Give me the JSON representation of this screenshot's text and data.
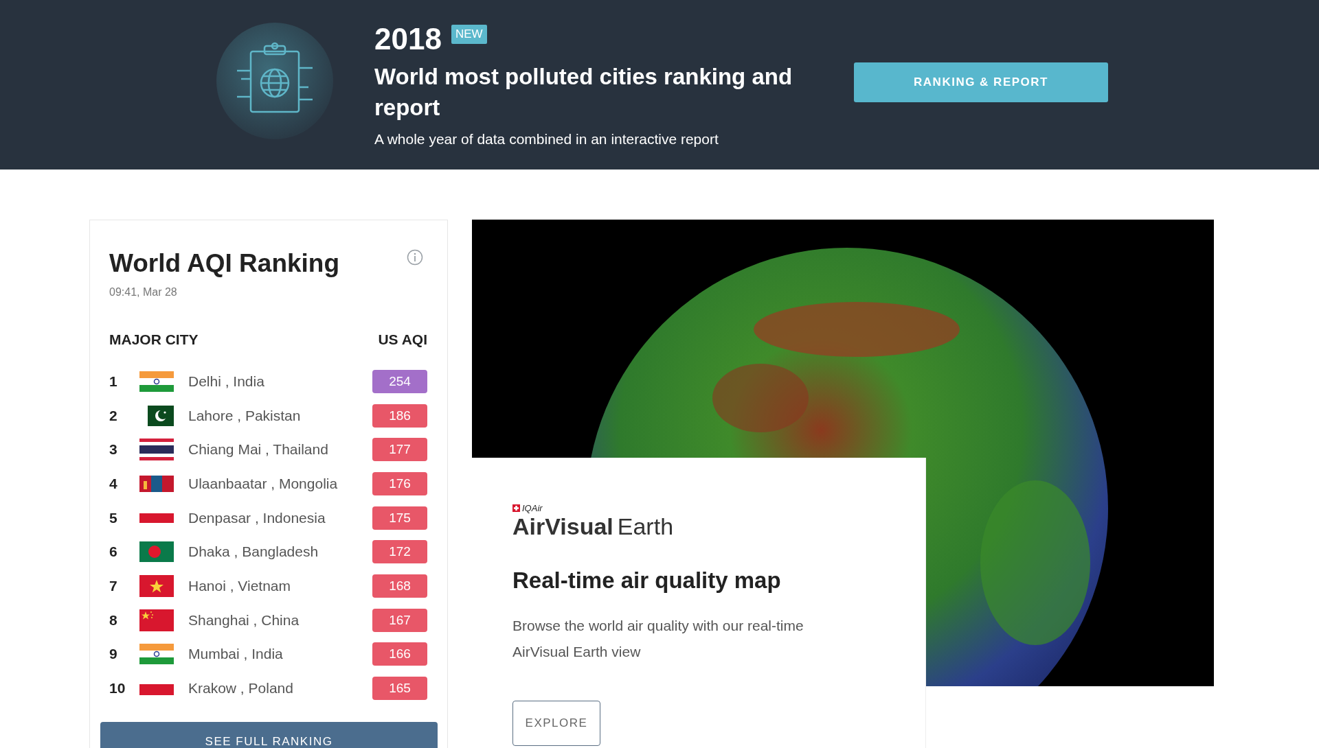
{
  "banner": {
    "year": "2018",
    "badge": "NEW",
    "title": "World most polluted cities ranking and report",
    "subtitle": "A whole year of data combined in an interactive report",
    "button": "RANKING & REPORT"
  },
  "ranking": {
    "title": "World AQI Ranking",
    "updated": "09:41, Mar 28",
    "columns": [
      "MAJOR CITY",
      "US AQI"
    ],
    "rows": [
      {
        "rank": "1",
        "kind": "india",
        "city": "Delhi , India",
        "aqi": "254",
        "color": "#a36fc9"
      },
      {
        "rank": "2",
        "kind": "pakistan",
        "city": "Lahore , Pakistan",
        "aqi": "186",
        "color": "#e85768"
      },
      {
        "rank": "3",
        "kind": "thailand",
        "city": "Chiang Mai , Thailand",
        "aqi": "177",
        "color": "#e85768"
      },
      {
        "rank": "4",
        "kind": "mongolia",
        "city": "Ulaanbaatar , Mongolia",
        "aqi": "176",
        "color": "#e85768"
      },
      {
        "rank": "5",
        "kind": "indonesia",
        "city": "Denpasar , Indonesia",
        "aqi": "175",
        "color": "#e85768"
      },
      {
        "rank": "6",
        "kind": "bangladesh",
        "city": "Dhaka , Bangladesh",
        "aqi": "172",
        "color": "#e85768"
      },
      {
        "rank": "7",
        "kind": "vietnam",
        "city": "Hanoi , Vietnam",
        "aqi": "168",
        "color": "#e85768"
      },
      {
        "rank": "8",
        "kind": "china",
        "city": "Shanghai , China",
        "aqi": "167",
        "color": "#e85768"
      },
      {
        "rank": "9",
        "kind": "india",
        "city": "Mumbai , India",
        "aqi": "166",
        "color": "#e85768"
      },
      {
        "rank": "10",
        "kind": "poland",
        "city": "Krakow , Poland",
        "aqi": "165",
        "color": "#e85768"
      }
    ],
    "button": "SEE FULL RANKING"
  },
  "earth": {
    "logo": {
      "brand": "IQAir",
      "name_bold": "AirVisual",
      "name": "Earth"
    },
    "title": "Real-time air quality map",
    "description": "Browse the world air quality with our real-time AirVisual Earth view",
    "button": "EXPLORE"
  }
}
